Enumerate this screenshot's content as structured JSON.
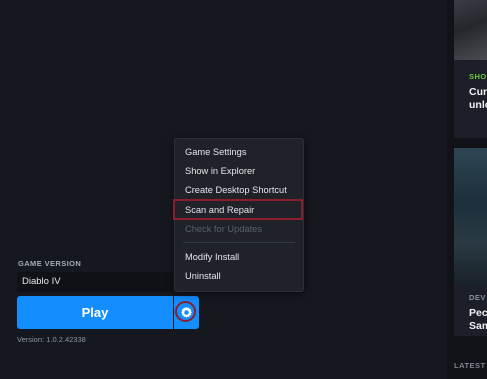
{
  "right_panel": {
    "cards": [
      {
        "tag": "SHO",
        "title_lines": [
          "Cur",
          "unlo"
        ]
      },
      {
        "tag": "DEV",
        "title_lines": [
          "Pec",
          "Sam"
        ]
      }
    ],
    "latest_label": "LATEST"
  },
  "game": {
    "version_label": "GAME VERSION",
    "selected_version": "Diablo IV",
    "play_label": "Play",
    "version_text": "Version: 1.0.2.42338"
  },
  "context_menu": {
    "items": [
      {
        "label": "Game Settings",
        "enabled": true
      },
      {
        "label": "Show in Explorer",
        "enabled": true
      },
      {
        "label": "Create Desktop Shortcut",
        "enabled": true
      },
      {
        "label": "Scan and Repair",
        "enabled": true,
        "highlighted": true
      },
      {
        "label": "Check for Updates",
        "enabled": false
      },
      {
        "label": "Modify Install",
        "enabled": true
      },
      {
        "label": "Uninstall",
        "enabled": true
      }
    ]
  },
  "colors": {
    "accent": "#148eff",
    "highlight_border": "#8b1e2c",
    "tag_green": "#71c83a",
    "background": "#16181f"
  },
  "icons": {
    "settings": "gear-icon"
  }
}
